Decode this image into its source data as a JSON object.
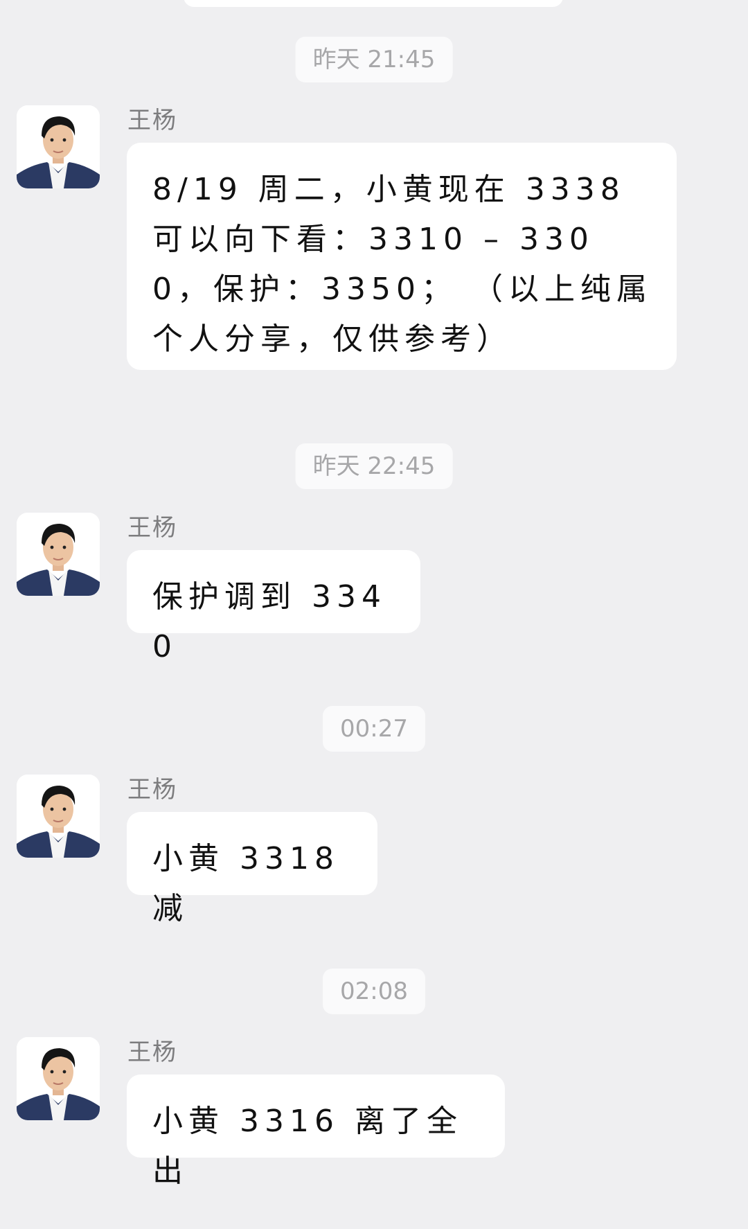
{
  "timestamps": [
    "昨天 21:45",
    "昨天 22:45",
    "00:27",
    "02:08"
  ],
  "messages": [
    {
      "sender": "王杨",
      "text": "8/19 周二，小黄现在 3338 可以向下看：3310 – 3300，保护：3350； （以上纯属个人分享，仅供参考）"
    },
    {
      "sender": "王杨",
      "text": "保护调到 3340"
    },
    {
      "sender": "王杨",
      "text": "小黄 3318 减"
    },
    {
      "sender": "王杨",
      "text": "小黄 3316 离了全出"
    }
  ],
  "colors": {
    "background": "#efeff1",
    "bubble": "#ffffff",
    "timestamp_bg": "#fafafb",
    "timestamp_text": "#a7a7a9",
    "sender_text": "#7c7c7e"
  },
  "icons": [
    "avatar-photo"
  ]
}
